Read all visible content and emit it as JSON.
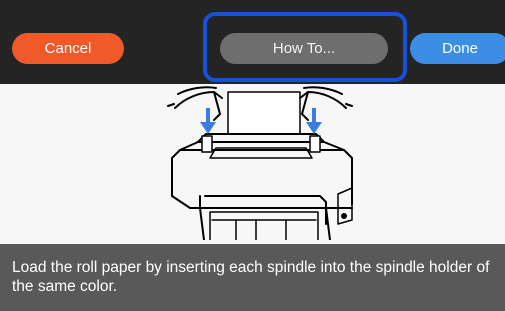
{
  "header": {
    "cancel_label": "Cancel",
    "howto_label": "How To...",
    "done_label": "Done"
  },
  "caption": {
    "text": "Load the roll paper by inserting each spindle into the spindle holder of the same color."
  },
  "colors": {
    "cancel": "#f05a2a",
    "howto": "#6e6e6e",
    "done": "#3b8ee3",
    "highlight": "#1652d8",
    "arrow": "#3a7fe0"
  },
  "icons": {
    "left_arrow": "arrow-down-icon",
    "right_arrow": "arrow-down-icon"
  }
}
